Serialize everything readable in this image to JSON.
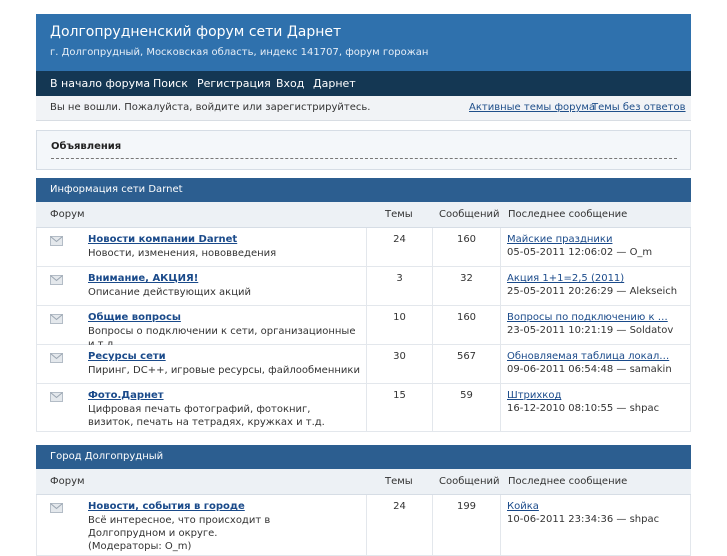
{
  "header": {
    "title": "Долгопрудненский форум сети Дарнет",
    "description": "г. Долгопрудный, Московская область, индекс 141707, форум горожан"
  },
  "nav": {
    "items": [
      "В начало форума",
      "Поиск",
      "Регистрация",
      "Вход",
      "Дарнет"
    ]
  },
  "welcome": {
    "message": "Вы не вошли. Пожалуйста, войдите или зарегистрируйтесь.",
    "active_topics": "Активные темы форума",
    "unanswered": "Темы без ответов"
  },
  "announcements": {
    "label": "Объявления"
  },
  "columns": {
    "forum": "Форум",
    "topics": "Темы",
    "posts": "Сообщений",
    "last_post": "Последнее сообщение"
  },
  "categories": [
    {
      "title": "Информация сети Darnet",
      "forums": [
        {
          "name": "Новости компании Darnet",
          "desc": "Новости, изменения, нововведения",
          "topics": "24",
          "posts": "160",
          "last_title": "Майские праздники",
          "last_meta": "05-05-2011 12:06:02 — O_m"
        },
        {
          "name": "Внимание, АКЦИЯ!",
          "desc": "Описание действующих акций",
          "topics": "3",
          "posts": "32",
          "last_title": "Акция 1+1=2,5 (2011)",
          "last_meta": "25-05-2011 20:26:29 — Alekseich"
        },
        {
          "name": "Общие вопросы",
          "desc": "Вопросы о подключении к сети, организационные и т.д.",
          "topics": "10",
          "posts": "160",
          "last_title": "Вопросы по подключению к …",
          "last_meta": "23-05-2011 10:21:19 — Soldatov"
        },
        {
          "name": "Ресурсы сети",
          "desc": "Пиринг, DC++, игровые ресурсы, файлообменники",
          "topics": "30",
          "posts": "567",
          "last_title": "Обновляемая таблица локал…",
          "last_meta": "09-06-2011 06:54:48 — samakin"
        },
        {
          "name": "Фото.Дарнет",
          "desc": "Цифровая печать фотографий, фотокниг, визиток, печать на тетрадях, кружках и т.д.",
          "topics": "15",
          "posts": "59",
          "last_title": "Штрихкод",
          "last_meta": "16-12-2010 08:10:55 — shpac"
        }
      ]
    },
    {
      "title": "Город Долгопрудный",
      "forums": [
        {
          "name": "Новости, события в городе",
          "desc": "Всё интересное, что происходит в Долгопрудном и округе.",
          "moderators": "(Модераторы: O_m)",
          "topics": "24",
          "posts": "199",
          "last_title": "Койка",
          "last_meta": "10-06-2011 23:34:36 — shpac"
        }
      ]
    }
  ]
}
